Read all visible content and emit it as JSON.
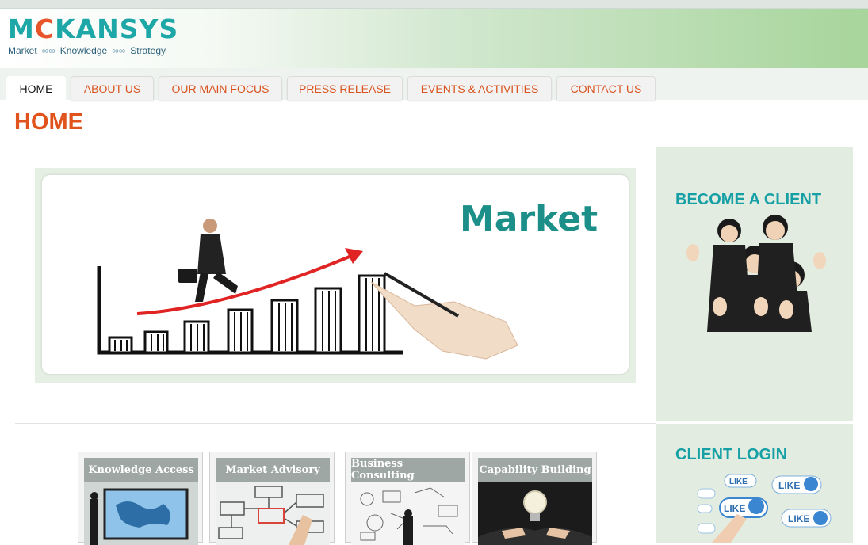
{
  "header": {
    "logo_prefix": "M",
    "logo_c": "C",
    "logo_suffix": "KANSYS",
    "tagline": [
      "Market",
      "Knowledge",
      "Strategy"
    ]
  },
  "nav": {
    "tabs": [
      {
        "label": "HOME"
      },
      {
        "label": "ABOUT US"
      },
      {
        "label": "OUR MAIN FOCUS"
      },
      {
        "label": "PRESS RELEASE"
      },
      {
        "label": "EVENTS & ACTIVITIES"
      },
      {
        "label": "CONTACT US"
      }
    ]
  },
  "main": {
    "title": "HOME",
    "banner_word": "Market",
    "tiles": [
      {
        "label": "Knowledge Access"
      },
      {
        "label": "Market Advisory"
      },
      {
        "label": "Business Consulting"
      },
      {
        "label": "Capability Building"
      }
    ]
  },
  "sidebar": {
    "become_client": "BECOME A CLIENT",
    "client_login": "CLIENT LOGIN",
    "like_label": "LIKE"
  },
  "colors": {
    "accent": "#e0531c",
    "teal": "#16a0a6",
    "side_bg": "#e3ece1"
  }
}
